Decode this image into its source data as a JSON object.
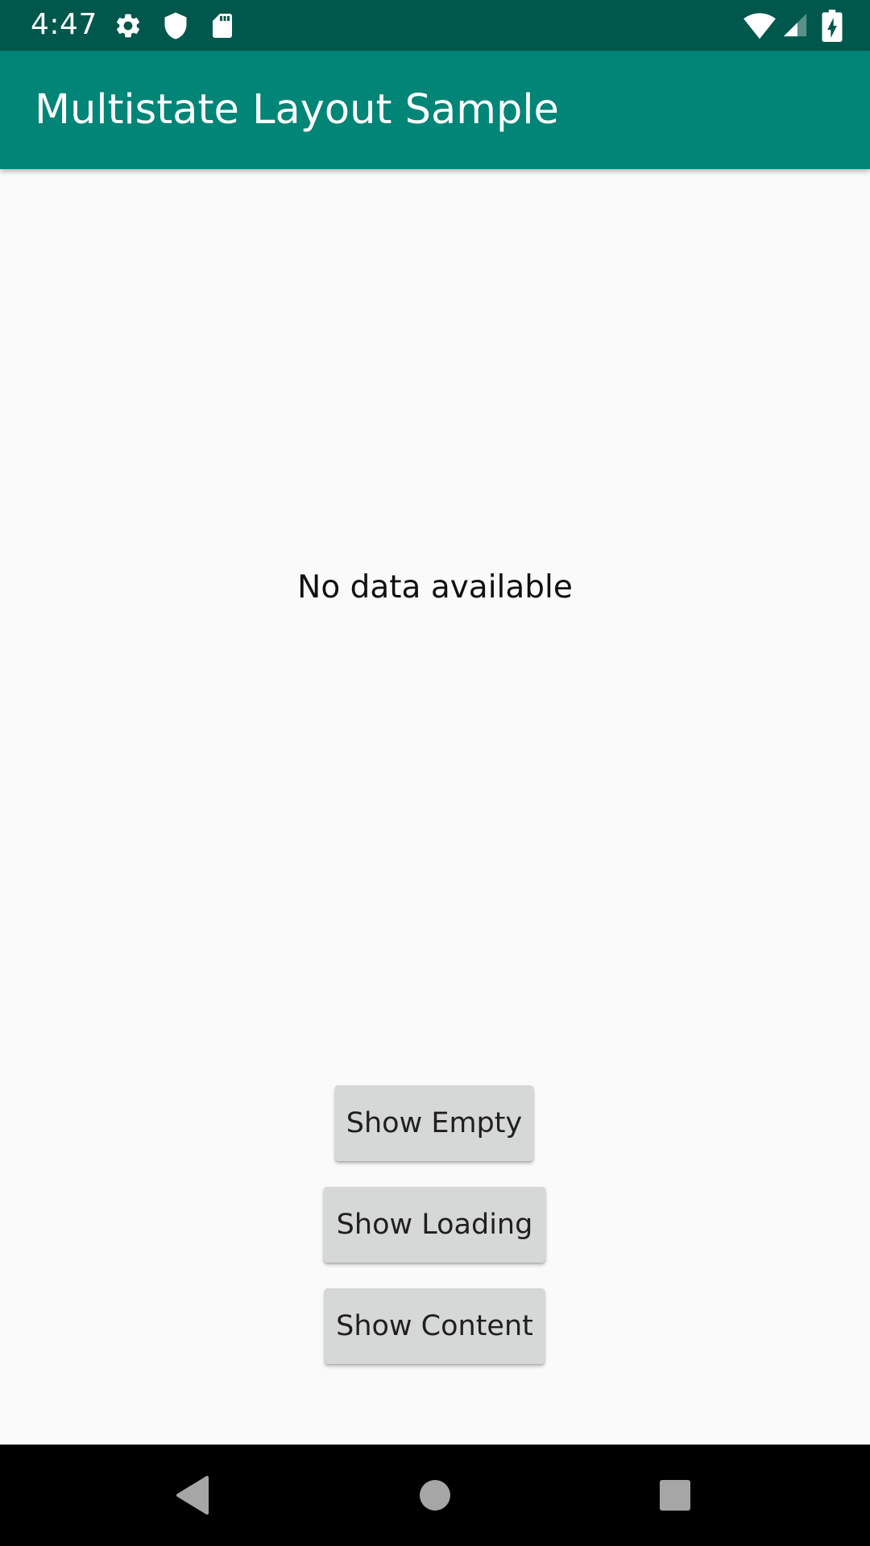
{
  "status_bar": {
    "time": "4:47",
    "icons": [
      "settings-icon",
      "shield-icon",
      "sd-card-icon",
      "wifi-icon",
      "cell-signal-icon",
      "battery-charging-icon"
    ]
  },
  "app_bar": {
    "title": "Multistate Layout Sample"
  },
  "main": {
    "empty_message": "No data available"
  },
  "buttons": {
    "show_empty": "Show Empty",
    "show_loading": "Show Loading",
    "show_content": "Show Content"
  },
  "nav_bar": {
    "items": [
      "back-icon",
      "home-icon",
      "recents-icon"
    ]
  },
  "colors": {
    "status_bar": "#00574b",
    "app_bar": "#008577",
    "background": "#fafafa",
    "button": "#d6d7d7",
    "nav_bar": "#000000"
  }
}
